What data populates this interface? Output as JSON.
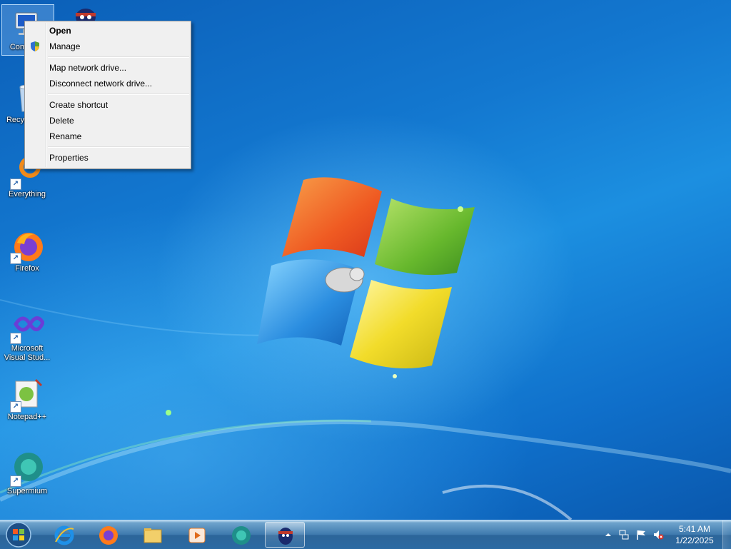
{
  "desktop": {
    "icons": [
      {
        "label": "Computer",
        "icon": "computer-icon",
        "selected": true
      },
      {
        "label": "",
        "icon": "penguin-icon"
      },
      {
        "label": "Recycle Bin",
        "icon": "recycle-bin-icon"
      },
      {
        "label": "Everything",
        "icon": "everything-icon",
        "shortcut": true
      },
      {
        "label": "Firefox",
        "icon": "firefox-icon",
        "shortcut": true
      },
      {
        "label": "Microsoft Visual Stud...",
        "icon": "visual-studio-icon",
        "shortcut": true
      },
      {
        "label": "Notepad++",
        "icon": "notepadpp-icon",
        "shortcut": true
      },
      {
        "label": "Supermium",
        "icon": "supermium-icon",
        "shortcut": true
      }
    ]
  },
  "context_menu": {
    "items": [
      {
        "label": "Open",
        "bold": true
      },
      {
        "label": "Manage",
        "icon": "uac-shield-icon"
      },
      {
        "label": "Map network drive..."
      },
      {
        "label": "Disconnect network drive..."
      },
      {
        "label": "Create shortcut"
      },
      {
        "label": "Delete"
      },
      {
        "label": "Rename"
      },
      {
        "label": "Properties"
      }
    ]
  },
  "taskbar": {
    "start_icon": "windows-start-orb-icon",
    "pinned": [
      {
        "icon": "internet-explorer-icon"
      },
      {
        "icon": "firefox-icon"
      },
      {
        "icon": "file-explorer-icon"
      },
      {
        "icon": "media-player-icon"
      },
      {
        "icon": "supermium-icon"
      },
      {
        "icon": "penguin-icon",
        "active": true
      }
    ],
    "tray": {
      "icons": [
        "show-hidden-icons-chevron",
        "network-icon",
        "action-center-flag-icon",
        "volume-muted-icon"
      ],
      "time": "5:41 AM",
      "date": "1/22/2025"
    }
  },
  "colors": {
    "desktop_blue": "#1378d0",
    "menu_bg": "#f0f0f0",
    "taskbar": "#3d79ad"
  }
}
